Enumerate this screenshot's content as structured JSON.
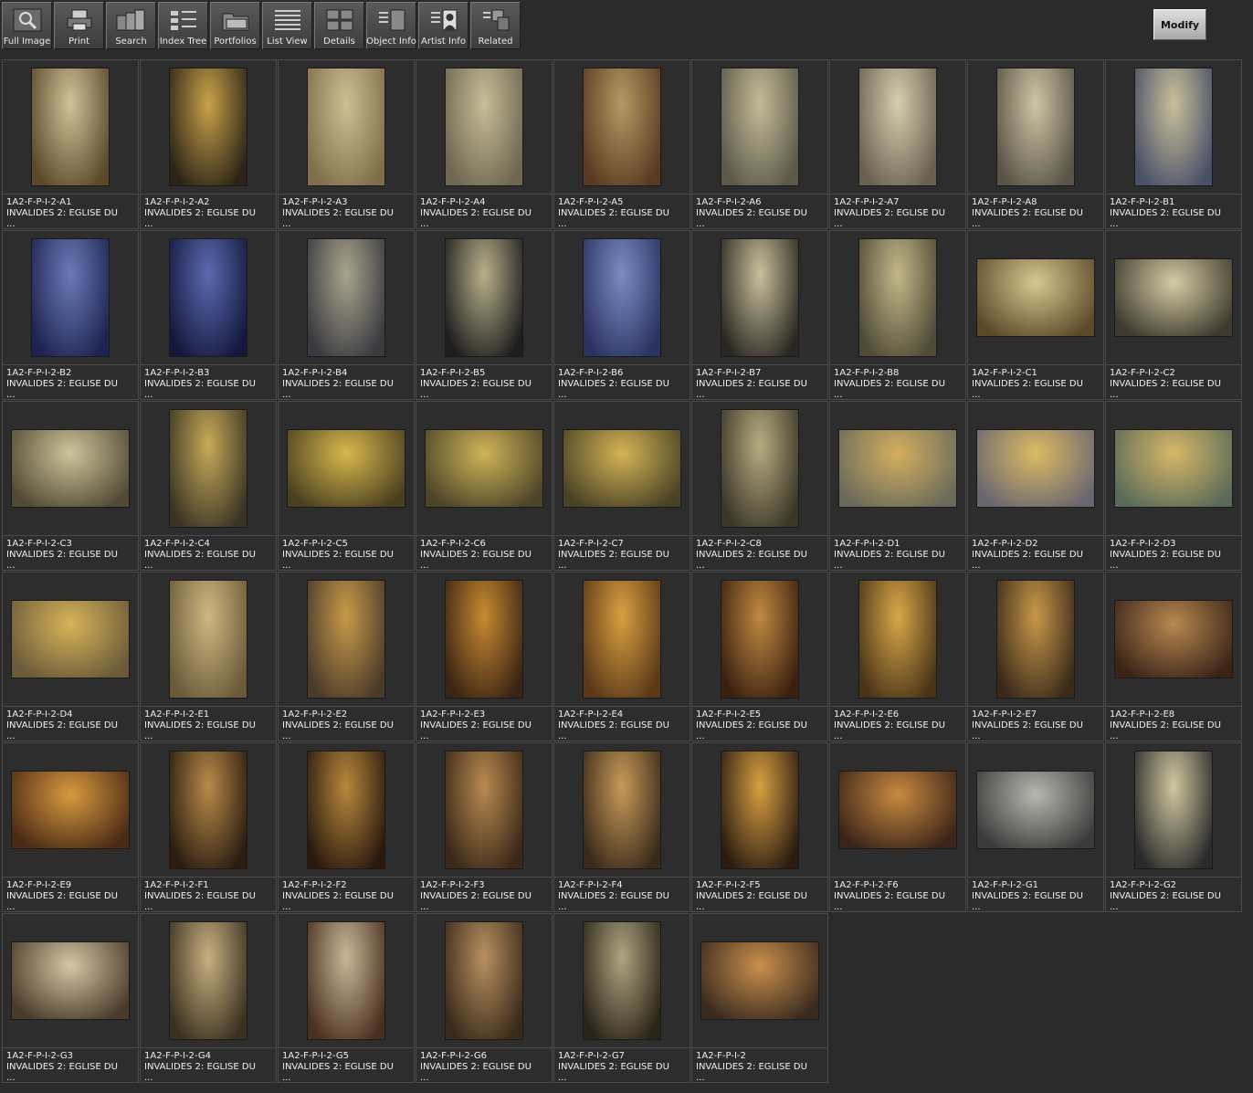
{
  "toolbar": [
    {
      "label": "Full Image",
      "icon": "magnifier-icon"
    },
    {
      "label": "Print",
      "icon": "printer-icon"
    },
    {
      "label": "Search",
      "icon": "search-cards-icon"
    },
    {
      "label": "Index Tree",
      "icon": "index-tree-icon"
    },
    {
      "label": "Portfolios",
      "icon": "folder-icon"
    },
    {
      "label": "List View",
      "icon": "list-view-icon"
    },
    {
      "label": "Details",
      "icon": "details-grid-icon"
    },
    {
      "label": "Object Info",
      "icon": "object-info-icon"
    },
    {
      "label": "Artist  Info",
      "icon": "artist-info-icon"
    },
    {
      "label": "Related",
      "icon": "related-icon"
    }
  ],
  "modify_label": "Modify",
  "items": [
    {
      "id": "1A2-F-P-I-2-A1",
      "title": "INVALIDES 2: EGLISE DU",
      "more": "...",
      "orientation": "portrait",
      "colors": [
        "#cfc39a",
        "#5b4a2a"
      ]
    },
    {
      "id": "1A2-F-P-I-2-A2",
      "title": "INVALIDES 2: EGLISE DU",
      "more": "...",
      "orientation": "portrait",
      "colors": [
        "#c9a24a",
        "#2a2316"
      ]
    },
    {
      "id": "1A2-F-P-I-2-A3",
      "title": "INVALIDES 2: EGLISE DU",
      "more": "...",
      "orientation": "portrait",
      "colors": [
        "#cdbf95",
        "#7e6f4a"
      ]
    },
    {
      "id": "1A2-F-P-I-2-A4",
      "title": "INVALIDES 2: EGLISE DU",
      "more": "...",
      "orientation": "portrait",
      "colors": [
        "#c8be98",
        "#6e6650"
      ]
    },
    {
      "id": "1A2-F-P-I-2-A5",
      "title": "INVALIDES 2: EGLISE DU",
      "more": "...",
      "orientation": "portrait",
      "colors": [
        "#b49a62",
        "#5a3a22"
      ]
    },
    {
      "id": "1A2-F-P-I-2-A6",
      "title": "INVALIDES 2: EGLISE DU",
      "more": "...",
      "orientation": "portrait",
      "colors": [
        "#c4bc98",
        "#5c584a"
      ]
    },
    {
      "id": "1A2-F-P-I-2-A7",
      "title": "INVALIDES 2: EGLISE DU",
      "more": "...",
      "orientation": "portrait",
      "colors": [
        "#d6cfb0",
        "#6a6050"
      ]
    },
    {
      "id": "1A2-F-P-I-2-A8",
      "title": "INVALIDES 2: EGLISE DU",
      "more": "...",
      "orientation": "portrait",
      "colors": [
        "#cdc6a4",
        "#5a5448"
      ]
    },
    {
      "id": "1A2-F-P-I-2-B1",
      "title": "INVALIDES 2: EGLISE DU",
      "more": "...",
      "orientation": "portrait",
      "colors": [
        "#c9c09a",
        "#4a5068"
      ]
    },
    {
      "id": "1A2-F-P-I-2-B2",
      "title": "INVALIDES 2: EGLISE DU",
      "more": "...",
      "orientation": "portrait",
      "colors": [
        "#6a7ab8",
        "#1e2450"
      ]
    },
    {
      "id": "1A2-F-P-I-2-B3",
      "title": "INVALIDES 2: EGLISE DU",
      "more": "...",
      "orientation": "portrait",
      "colors": [
        "#5a6ab0",
        "#14183c"
      ]
    },
    {
      "id": "1A2-F-P-I-2-B4",
      "title": "INVALIDES 2: EGLISE DU",
      "more": "...",
      "orientation": "portrait",
      "colors": [
        "#a8a48c",
        "#3a3a40"
      ]
    },
    {
      "id": "1A2-F-P-I-2-B5",
      "title": "INVALIDES 2: EGLISE DU",
      "more": "...",
      "orientation": "portrait",
      "colors": [
        "#b8b08a",
        "#1e1e1e"
      ]
    },
    {
      "id": "1A2-F-P-I-2-B6",
      "title": "INVALIDES 2: EGLISE DU",
      "more": "...",
      "orientation": "portrait",
      "colors": [
        "#7a8cc4",
        "#2a3260"
      ]
    },
    {
      "id": "1A2-F-P-I-2-B7",
      "title": "INVALIDES 2: EGLISE DU",
      "more": "...",
      "orientation": "portrait",
      "colors": [
        "#c8c09c",
        "#2a2820"
      ]
    },
    {
      "id": "1A2-F-P-I-2-B8",
      "title": "INVALIDES 2: EGLISE DU",
      "more": "...",
      "orientation": "portrait",
      "colors": [
        "#c4b88a",
        "#4e4a36"
      ]
    },
    {
      "id": "1A2-F-P-I-2-C1",
      "title": "INVALIDES 2: EGLISE DU",
      "more": "...",
      "orientation": "landscape",
      "colors": [
        "#d8c890",
        "#5a4a2a"
      ]
    },
    {
      "id": "1A2-F-P-I-2-C2",
      "title": "INVALIDES 2: EGLISE DU",
      "more": "...",
      "orientation": "landscape",
      "colors": [
        "#d4cca4",
        "#3e3a2e"
      ]
    },
    {
      "id": "1A2-F-P-I-2-C3",
      "title": "INVALIDES 2: EGLISE DU",
      "more": "...",
      "orientation": "landscape",
      "colors": [
        "#cec49a",
        "#524a34"
      ]
    },
    {
      "id": "1A2-F-P-I-2-C4",
      "title": "INVALIDES 2: EGLISE DU",
      "more": "...",
      "orientation": "portrait",
      "colors": [
        "#c8aa58",
        "#3a3424"
      ]
    },
    {
      "id": "1A2-F-P-I-2-C5",
      "title": "INVALIDES 2: EGLISE DU",
      "more": "...",
      "orientation": "landscape",
      "colors": [
        "#d8b84c",
        "#4a4020"
      ]
    },
    {
      "id": "1A2-F-P-I-2-C6",
      "title": "INVALIDES 2: EGLISE DU",
      "more": "...",
      "orientation": "landscape",
      "colors": [
        "#d0b458",
        "#4c4428"
      ]
    },
    {
      "id": "1A2-F-P-I-2-C7",
      "title": "INVALIDES 2: EGLISE DU",
      "more": "...",
      "orientation": "landscape",
      "colors": [
        "#d4b454",
        "#4a4226"
      ]
    },
    {
      "id": "1A2-F-P-I-2-C8",
      "title": "INVALIDES 2: EGLISE DU",
      "more": "...",
      "orientation": "portrait",
      "colors": [
        "#b8ac80",
        "#3a3628"
      ]
    },
    {
      "id": "1A2-F-P-I-2-D1",
      "title": "INVALIDES 2: EGLISE DU",
      "more": "...",
      "orientation": "landscape",
      "colors": [
        "#d4b060",
        "#6a6a5a"
      ]
    },
    {
      "id": "1A2-F-P-I-2-D2",
      "title": "INVALIDES 2: EGLISE DU",
      "more": "...",
      "orientation": "landscape",
      "colors": [
        "#dcbc64",
        "#6a6670"
      ]
    },
    {
      "id": "1A2-F-P-I-2-D3",
      "title": "INVALIDES 2: EGLISE DU",
      "more": "...",
      "orientation": "landscape",
      "colors": [
        "#d8b868",
        "#5a6a58"
      ]
    },
    {
      "id": "1A2-F-P-I-2-D4",
      "title": "INVALIDES 2: EGLISE DU",
      "more": "...",
      "orientation": "landscape",
      "colors": [
        "#d8b458",
        "#6a5a3a"
      ]
    },
    {
      "id": "1A2-F-P-I-2-E1",
      "title": "INVALIDES 2: EGLISE DU",
      "more": "...",
      "orientation": "portrait",
      "colors": [
        "#cfb880",
        "#6a5a3a"
      ]
    },
    {
      "id": "1A2-F-P-I-2-E2",
      "title": "INVALIDES 2: EGLISE DU",
      "more": "...",
      "orientation": "portrait",
      "colors": [
        "#c89a48",
        "#4a3a2a"
      ]
    },
    {
      "id": "1A2-F-P-I-2-E3",
      "title": "INVALIDES 2: EGLISE DU",
      "more": "...",
      "orientation": "portrait",
      "colors": [
        "#c88a30",
        "#3a2414"
      ]
    },
    {
      "id": "1A2-F-P-I-2-E4",
      "title": "INVALIDES 2: EGLISE DU",
      "more": "...",
      "orientation": "portrait",
      "colors": [
        "#d8a040",
        "#5a3818"
      ]
    },
    {
      "id": "1A2-F-P-I-2-E5",
      "title": "INVALIDES 2: EGLISE DU",
      "more": "...",
      "orientation": "portrait",
      "colors": [
        "#c08a40",
        "#3a2010"
      ]
    },
    {
      "id": "1A2-F-P-I-2-E6",
      "title": "INVALIDES 2: EGLISE DU",
      "more": "...",
      "orientation": "portrait",
      "colors": [
        "#d8a848",
        "#4a3418"
      ]
    },
    {
      "id": "1A2-F-P-I-2-E7",
      "title": "INVALIDES 2: EGLISE DU",
      "more": "...",
      "orientation": "portrait",
      "colors": [
        "#c89848",
        "#3a2a1a"
      ]
    },
    {
      "id": "1A2-F-P-I-2-E8",
      "title": "INVALIDES 2: EGLISE DU",
      "more": "...",
      "orientation": "landscape",
      "colors": [
        "#b88850",
        "#3a2418"
      ]
    },
    {
      "id": "1A2-F-P-I-2-E9",
      "title": "INVALIDES 2: EGLISE DU",
      "more": "...",
      "orientation": "landscape",
      "colors": [
        "#d89a40",
        "#4a2a14"
      ]
    },
    {
      "id": "1A2-F-P-I-2-F1",
      "title": "INVALIDES 2: EGLISE DU",
      "more": "...",
      "orientation": "portrait",
      "colors": [
        "#b88a48",
        "#2a1c10"
      ]
    },
    {
      "id": "1A2-F-P-I-2-F2",
      "title": "INVALIDES 2: EGLISE DU",
      "more": "...",
      "orientation": "portrait",
      "colors": [
        "#b8883c",
        "#2a1a0e"
      ]
    },
    {
      "id": "1A2-F-P-I-2-F3",
      "title": "INVALIDES 2: EGLISE DU",
      "more": "...",
      "orientation": "portrait",
      "colors": [
        "#b88a50",
        "#3a2818"
      ]
    },
    {
      "id": "1A2-F-P-I-2-F4",
      "title": "INVALIDES 2: EGLISE DU",
      "more": "...",
      "orientation": "portrait",
      "colors": [
        "#c89a58",
        "#3a2a1a"
      ]
    },
    {
      "id": "1A2-F-P-I-2-F5",
      "title": "INVALIDES 2: EGLISE DU",
      "more": "...",
      "orientation": "portrait",
      "colors": [
        "#d8a040",
        "#2a1c12"
      ]
    },
    {
      "id": "1A2-F-P-I-2-F6",
      "title": "INVALIDES 2: EGLISE DU",
      "more": "...",
      "orientation": "landscape",
      "colors": [
        "#c88a40",
        "#3a2418"
      ]
    },
    {
      "id": "1A2-F-P-I-2-G1",
      "title": "INVALIDES 2: EGLISE DU",
      "more": "...",
      "orientation": "landscape",
      "colors": [
        "#b8b8b0",
        "#3a3a3a"
      ]
    },
    {
      "id": "1A2-F-P-I-2-G2",
      "title": "INVALIDES 2: EGLISE DU",
      "more": "...",
      "orientation": "portrait",
      "colors": [
        "#d0c8a0",
        "#2a2a2a"
      ]
    },
    {
      "id": "1A2-F-P-I-2-G3",
      "title": "INVALIDES 2: EGLISE DU",
      "more": "...",
      "orientation": "landscape",
      "colors": [
        "#d4c8a4",
        "#4a3a2a"
      ]
    },
    {
      "id": "1A2-F-P-I-2-G4",
      "title": "INVALIDES 2: EGLISE DU",
      "more": "...",
      "orientation": "portrait",
      "colors": [
        "#c8b080",
        "#3a3020"
      ]
    },
    {
      "id": "1A2-F-P-I-2-G5",
      "title": "INVALIDES 2: EGLISE DU",
      "more": "...",
      "orientation": "portrait",
      "colors": [
        "#c8b898",
        "#4a3020"
      ]
    },
    {
      "id": "1A2-F-P-I-2-G6",
      "title": "INVALIDES 2: EGLISE DU",
      "more": "...",
      "orientation": "portrait",
      "colors": [
        "#b89060",
        "#3a2a1a"
      ]
    },
    {
      "id": "1A2-F-P-I-2-G7",
      "title": "INVALIDES 2: EGLISE DU",
      "more": "...",
      "orientation": "portrait",
      "colors": [
        "#b0a480",
        "#2a2418"
      ]
    },
    {
      "id": "1A2-F-P-I-2",
      "title": "INVALIDES 2: EGLISE DU",
      "more": "...",
      "orientation": "landscape",
      "colors": [
        "#c8904a",
        "#3a2a20"
      ]
    }
  ]
}
